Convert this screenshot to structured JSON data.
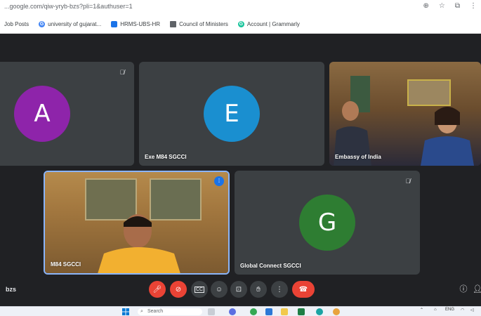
{
  "browser": {
    "url": "...google.com/qiw-yryb-bzs?pli=1&authuser=1",
    "bookmarks": [
      {
        "label": "Job Posts",
        "icon": "bookmark-icon",
        "color": "#5f6368"
      },
      {
        "label": "university of gujarat...",
        "icon": "google-icon",
        "color": "#4285f4"
      },
      {
        "label": "HRMS-UBS-HR",
        "icon": "hrms-icon",
        "color": "#1a73e8"
      },
      {
        "label": "Council of Ministers",
        "icon": "emblem-icon",
        "color": "#5f6368"
      },
      {
        "label": "Account | Grammarly",
        "icon": "grammarly-icon",
        "color": "#15c39a"
      }
    ]
  },
  "tiles": {
    "a": {
      "letter": "A",
      "color": "#8e24aa",
      "muted": true
    },
    "e": {
      "letter": "E",
      "color": "#1a8fd0",
      "name": "Exe M84 SGCCI"
    },
    "embassy": {
      "name": "Embassy of India"
    },
    "m84": {
      "name": "M84 SGCCI"
    },
    "g": {
      "letter": "G",
      "color": "#2e7d32",
      "name": "Global Connect SGCCI",
      "muted": true
    }
  },
  "controls": {
    "meeting_code": "bzs"
  },
  "taskbar": {
    "search_placeholder": "Search",
    "lang": "ENG"
  },
  "colors": {
    "stage_bg": "#202124",
    "tile_bg": "#3c4043",
    "danger": "#ea4335",
    "accent": "#1a73e8"
  }
}
